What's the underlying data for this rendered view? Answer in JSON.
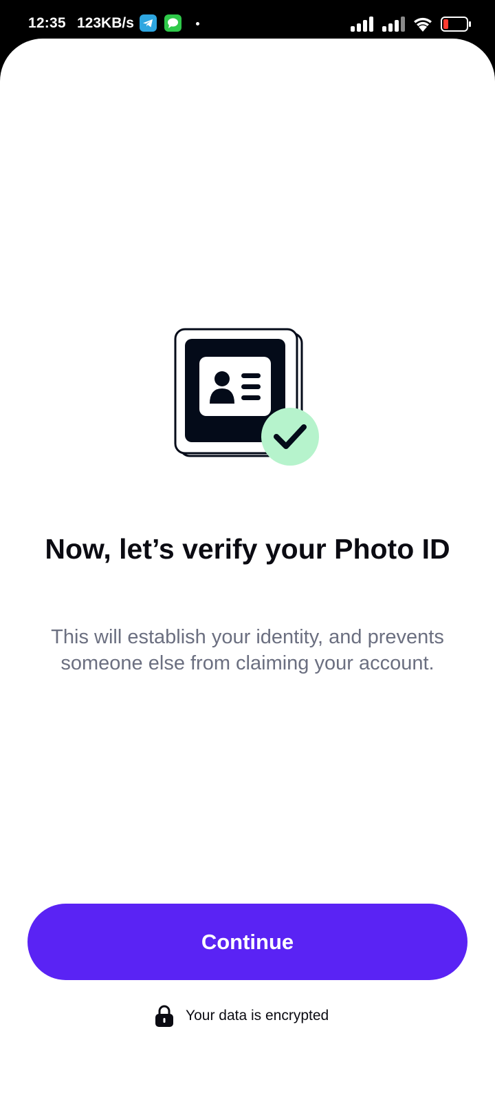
{
  "status_bar": {
    "time": "12:35",
    "net_speed": "123KB/s",
    "icons": [
      "telegram-icon",
      "messages-icon",
      "signal-icon",
      "signal-icon",
      "wifi-icon",
      "battery-low-icon"
    ]
  },
  "main": {
    "illustration": "photo-id-verified-icon",
    "title": "Now, let’s verify your Photo ID",
    "description": "This will establish your identity, and prevents someone else from claiming your account."
  },
  "actions": {
    "continue_label": "Continue"
  },
  "footer": {
    "encrypted_label": "Your data is encrypted",
    "icon": "lock-icon"
  },
  "colors": {
    "accent": "#5a23f4",
    "check_badge": "#b6f3cc",
    "id_card": "#040b19",
    "description": "#6b6f80"
  }
}
